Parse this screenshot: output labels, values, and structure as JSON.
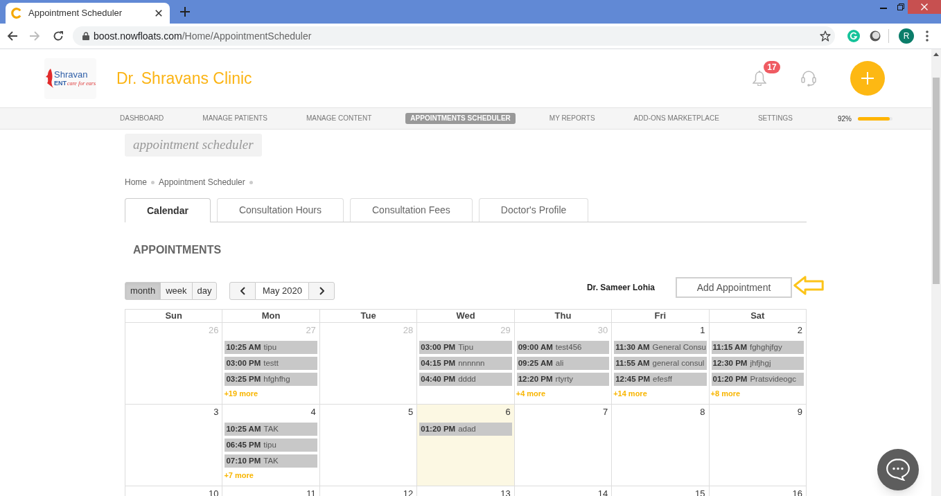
{
  "browser": {
    "tab": {
      "title": "Appointment Scheduler"
    },
    "address": {
      "domain": "boost.nowfloats.com",
      "path": "/Home/AppointmentScheduler"
    },
    "profile_initial": "R"
  },
  "header": {
    "logo": {
      "name": "Shravan",
      "line_2": "ENT",
      "tagline": "care for ears"
    },
    "clinic_name": "Dr. Shravans Clinic",
    "notification_count": "17"
  },
  "nav": {
    "items": [
      {
        "label": "DASHBOARD",
        "selected": false
      },
      {
        "label": "MANAGE PATIENTS",
        "selected": false
      },
      {
        "label": "MANAGE CONTENT",
        "selected": false
      },
      {
        "label": "APPOINTMENTS SCHEDULER",
        "selected": true
      },
      {
        "label": "MY REPORTS",
        "selected": false
      },
      {
        "label": "ADD-ONS MARKETPLACE",
        "selected": false
      },
      {
        "label": "SETTINGS",
        "selected": false
      }
    ],
    "profile_completion": {
      "reading": "92%",
      "level": 0.92
    }
  },
  "page_title": "appointment scheduler",
  "breadcrumb": [
    "Home",
    "Appointment Scheduler"
  ],
  "tabs": [
    {
      "label": "Calendar",
      "selected": true
    },
    {
      "label": "Consultation Hours",
      "selected": false
    },
    {
      "label": "Consultation Fees",
      "selected": false
    },
    {
      "label": "Doctor's Profile",
      "selected": false
    }
  ],
  "section_title": "APPOINTMENTS",
  "calendar": {
    "views": [
      {
        "label": "month",
        "selected": true
      },
      {
        "label": "week",
        "selected": false
      },
      {
        "label": "day",
        "selected": false
      }
    ],
    "period": "May 2020",
    "doctor": "Dr. Sameer Lohia",
    "add_button": "Add Appointment",
    "weekdays": [
      "Sun",
      "Mon",
      "Tue",
      "Wed",
      "Thu",
      "Fri",
      "Sat"
    ],
    "weeks": [
      {
        "days": [
          {
            "date": "26",
            "other_month": true,
            "today": false
          },
          {
            "date": "27",
            "other_month": true,
            "today": false,
            "events": [
              {
                "time": "10:25 AM",
                "title": "tipu"
              },
              {
                "time": "03:00 PM",
                "title": "testt"
              },
              {
                "time": "03:25 PM",
                "title": "hfghfhg"
              }
            ],
            "more": "+19 more"
          },
          {
            "date": "28",
            "other_month": true,
            "today": false
          },
          {
            "date": "29",
            "other_month": true,
            "today": false,
            "events": [
              {
                "time": "03:00 PM",
                "title": "Tipu"
              },
              {
                "time": "04:15 PM",
                "title": "nnnnnn"
              },
              {
                "time": "04:40 PM",
                "title": "dddd"
              }
            ]
          },
          {
            "date": "30",
            "other_month": true,
            "today": false,
            "events": [
              {
                "time": "09:00 AM",
                "title": "test456"
              },
              {
                "time": "09:25 AM",
                "title": "ali"
              },
              {
                "time": "12:20 PM",
                "title": "rtyrty"
              }
            ],
            "more": "+4 more"
          },
          {
            "date": "1",
            "other_month": false,
            "today": false,
            "events": [
              {
                "time": "11:30 AM",
                "title": "General Consu"
              },
              {
                "time": "11:55 AM",
                "title": "general consul"
              },
              {
                "time": "12:45 PM",
                "title": "efesff"
              }
            ],
            "more": "+14 more"
          },
          {
            "date": "2",
            "other_month": false,
            "today": false,
            "events": [
              {
                "time": "11:15 AM",
                "title": "fghghjfgy"
              },
              {
                "time": "12:30 PM",
                "title": "jhfjhgj"
              },
              {
                "time": "01:20 PM",
                "title": "Pratsvideogc"
              }
            ],
            "more": "+8 more"
          }
        ]
      },
      {
        "days": [
          {
            "date": "3",
            "other_month": false,
            "today": false
          },
          {
            "date": "4",
            "other_month": false,
            "today": false,
            "events": [
              {
                "time": "10:25 AM",
                "title": "TAK"
              },
              {
                "time": "06:45 PM",
                "title": "tipu"
              },
              {
                "time": "07:10 PM",
                "title": "TAK"
              }
            ],
            "more": "+7 more"
          },
          {
            "date": "5",
            "other_month": false,
            "today": false
          },
          {
            "date": "6",
            "other_month": false,
            "today": true,
            "events": [
              {
                "time": "01:20 PM",
                "title": "adad"
              }
            ]
          },
          {
            "date": "7",
            "other_month": false,
            "today": false
          },
          {
            "date": "8",
            "other_month": false,
            "today": false
          },
          {
            "date": "9",
            "other_month": false,
            "today": false
          }
        ]
      },
      {
        "days": [
          {
            "date": "10",
            "other_month": false,
            "today": false
          },
          {
            "date": "11",
            "other_month": false,
            "today": false
          },
          {
            "date": "12",
            "other_month": false,
            "today": false
          },
          {
            "date": "13",
            "other_month": false,
            "today": false
          },
          {
            "date": "14",
            "other_month": false,
            "today": false
          },
          {
            "date": "15",
            "other_month": false,
            "today": false
          },
          {
            "date": "16",
            "other_month": false,
            "today": false
          }
        ]
      }
    ]
  }
}
